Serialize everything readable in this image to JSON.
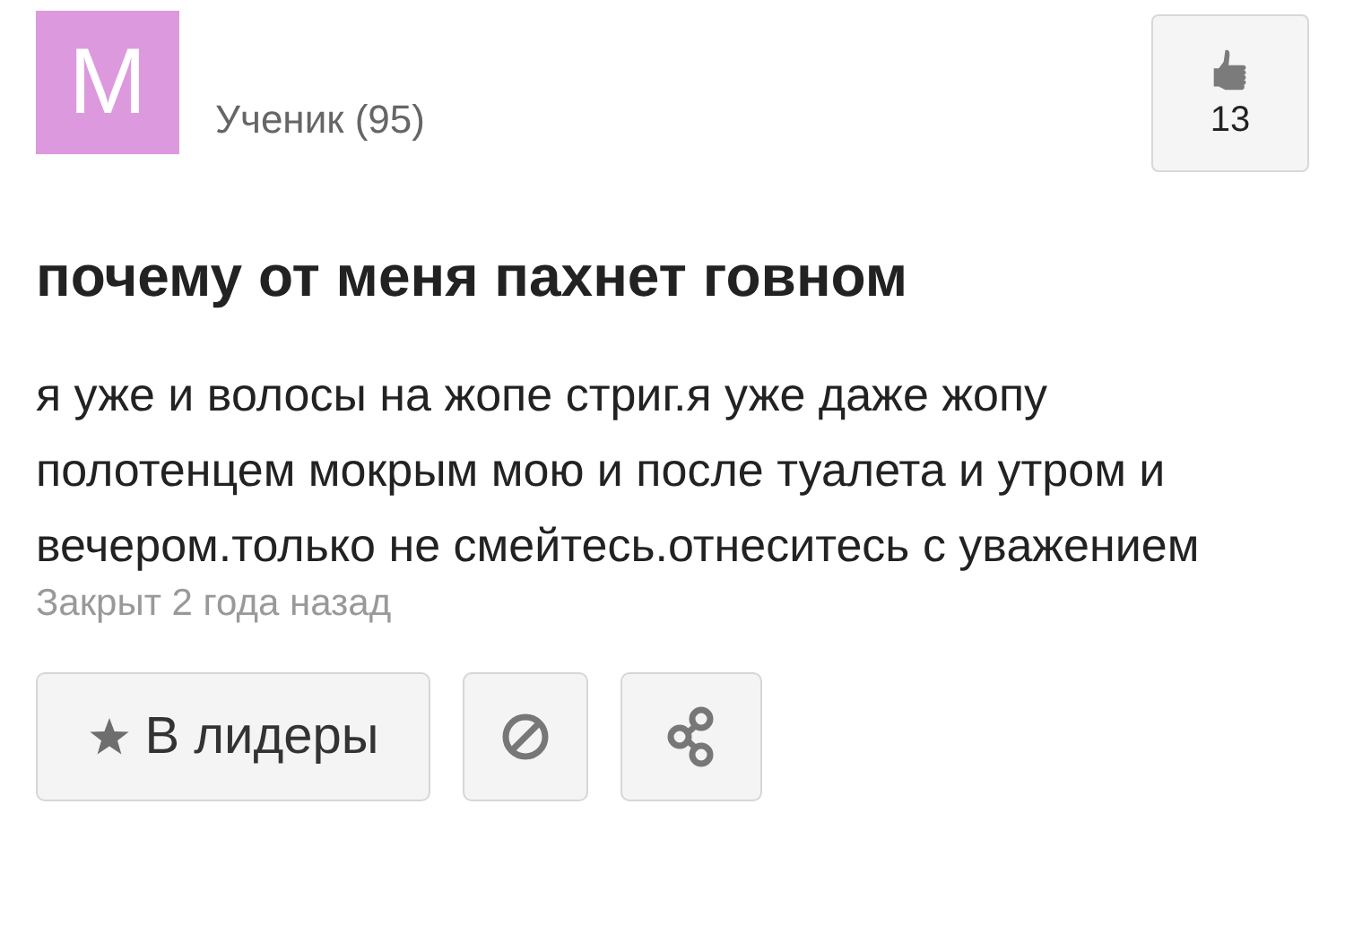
{
  "author": {
    "avatar_letter": "M",
    "rank": "Ученик (95)"
  },
  "like": {
    "count": "13"
  },
  "question": {
    "title": "почему от меня пахнет говном",
    "body": "я уже и волосы на жопе стриг.я уже даже жопу полотенцем мокрым мою и после туалета и утром и вечером.только не смейтесь.отнеситесь с уважением",
    "status": "Закрыт 2 года назад"
  },
  "actions": [
    {
      "kind": "leaders",
      "label": "В лидеры"
    },
    {
      "kind": "report"
    },
    {
      "kind": "share"
    }
  ]
}
